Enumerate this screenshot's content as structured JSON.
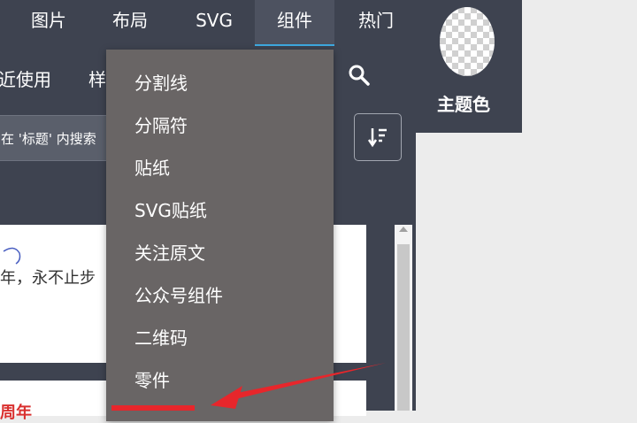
{
  "nav": {
    "tabs": [
      "图片",
      "布局",
      "SVG",
      "组件",
      "热门"
    ]
  },
  "subnav": {
    "recent": "近使用",
    "partial": "样"
  },
  "search": {
    "placeholder": "在 '标题' 内搜索"
  },
  "theme": {
    "label": "主题色"
  },
  "menu": {
    "items": [
      "分割线",
      "分隔符",
      "贴纸",
      "SVG贴纸",
      "关注原文",
      "公众号组件",
      "二维码",
      "零件"
    ]
  },
  "content": {
    "line1": "年，永不止步",
    "line2": "周年"
  },
  "colors": {
    "panel": "#3e4350",
    "menu": "#696565",
    "accent": "#3ea9e0",
    "arrow": "#e7262b"
  }
}
